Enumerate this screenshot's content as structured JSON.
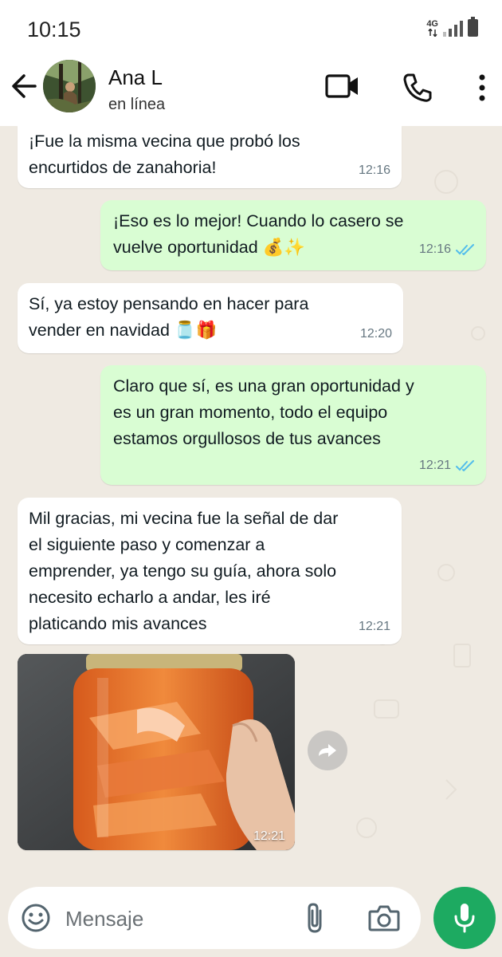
{
  "status_bar": {
    "time": "10:15",
    "network": "4G"
  },
  "header": {
    "contact_name": "Ana L",
    "contact_status": "en línea"
  },
  "messages": [
    {
      "direction": "in",
      "text": "¡Fue la misma vecina que probó los\nencurtidos de zanahoria!",
      "time": "12:16"
    },
    {
      "direction": "out",
      "text": "¡Eso es lo mejor! Cuando lo casero se\nvuelve oportunidad 💰✨",
      "time": "12:16",
      "read": true
    },
    {
      "direction": "in",
      "text": "Sí, ya estoy pensando en hacer para\nvender en navidad 🫙🎁",
      "time": "12:20"
    },
    {
      "direction": "out",
      "text": "Claro que sí, es una gran oportunidad y\nes un gran momento, todo el equipo\nestamos orgullosos de tus avances",
      "time": "12:21",
      "read": true
    },
    {
      "direction": "in",
      "text": "Mil gracias, mi vecina fue la señal de dar\nel siguiente paso y comenzar a\nemprender, ya tengo su guía, ahora solo\nnecesito echarlo a andar, les iré\nplaticando mis avances",
      "time": "12:21"
    },
    {
      "direction": "in",
      "type": "image",
      "description": "jar of pickled carrots",
      "time": "12:21"
    }
  ],
  "input": {
    "placeholder": "Mensaje"
  },
  "icons": {
    "back": "arrow-left-icon",
    "video": "video-camera-icon",
    "call": "phone-icon",
    "menu": "more-vert-icon",
    "emoji": "emoji-icon",
    "attach": "paperclip-icon",
    "camera": "camera-icon",
    "mic": "microphone-icon",
    "forward": "forward-icon",
    "read_ticks": "double-check-icon"
  },
  "colors": {
    "incoming_bubble": "#ffffff",
    "outgoing_bubble": "#d9fdd3",
    "chat_bg": "#efeae2",
    "read_ticks": "#53bdeb",
    "mic_button": "#1daa61"
  }
}
